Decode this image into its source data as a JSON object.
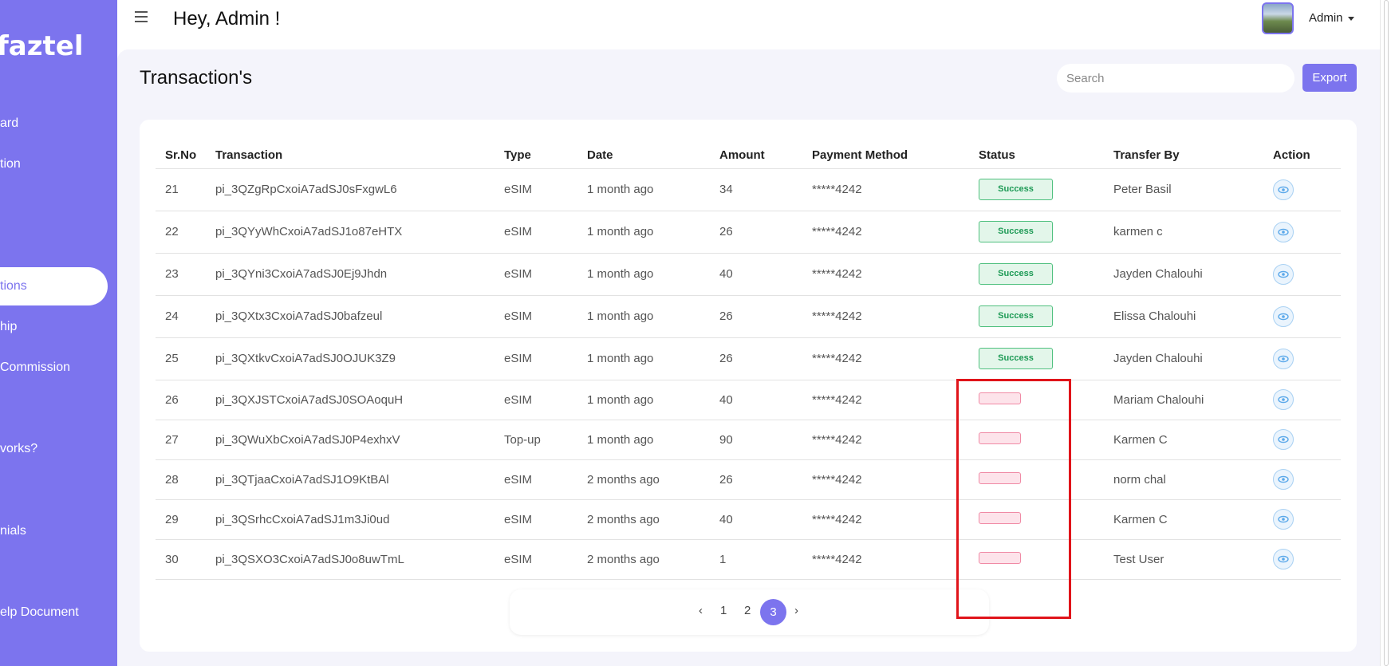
{
  "sidebar": {
    "logo": "faztel",
    "items": [
      {
        "label": "ard",
        "active": false
      },
      {
        "label": "tion",
        "active": false
      },
      {
        "label": "tions",
        "active": true
      },
      {
        "label": "hip",
        "active": false
      },
      {
        "label": " Commission",
        "active": false
      },
      {
        "label": "vorks?",
        "active": false
      },
      {
        "label": "nials",
        "active": false
      },
      {
        "label": "elp Document",
        "active": false
      }
    ]
  },
  "header": {
    "greeting": "Hey, Admin !",
    "user": "Admin"
  },
  "page": {
    "title": "Transaction's",
    "search_placeholder": "Search",
    "export_label": "Export"
  },
  "table": {
    "columns": [
      "Sr.No",
      "Transaction",
      "Type",
      "Date",
      "Amount",
      "Payment Method",
      "Status",
      "Transfer By",
      "Action"
    ],
    "rows": [
      {
        "sr": "21",
        "txn": "pi_3QZgRpCxoiA7adSJ0sFxgwL6",
        "type": "eSIM",
        "date": "1 month ago",
        "amount": "34",
        "method": "*****4242",
        "status": "Success",
        "by": "Peter Basil"
      },
      {
        "sr": "22",
        "txn": "pi_3QYyWhCxoiA7adSJ1o87eHTX",
        "type": "eSIM",
        "date": "1 month ago",
        "amount": "26",
        "method": "*****4242",
        "status": "Success",
        "by": "karmen c"
      },
      {
        "sr": "23",
        "txn": "pi_3QYni3CxoiA7adSJ0Ej9Jhdn",
        "type": "eSIM",
        "date": "1 month ago",
        "amount": "40",
        "method": "*****4242",
        "status": "Success",
        "by": "Jayden Chalouhi"
      },
      {
        "sr": "24",
        "txn": "pi_3QXtx3CxoiA7adSJ0bafzeul",
        "type": "eSIM",
        "date": "1 month ago",
        "amount": "26",
        "method": "*****4242",
        "status": "Success",
        "by": "Elissa Chalouhi"
      },
      {
        "sr": "25",
        "txn": "pi_3QXtkvCxoiA7adSJ0OJUK3Z9",
        "type": "eSIM",
        "date": "1 month ago",
        "amount": "26",
        "method": "*****4242",
        "status": "Success",
        "by": "Jayden Chalouhi"
      },
      {
        "sr": "26",
        "txn": "pi_3QXJSTCxoiA7adSJ0SOAoquH",
        "type": "eSIM",
        "date": "1 month ago",
        "amount": "40",
        "method": "*****4242",
        "status": "",
        "by": "Mariam Chalouhi"
      },
      {
        "sr": "27",
        "txn": "pi_3QWuXbCxoiA7adSJ0P4exhxV",
        "type": "Top-up",
        "date": "1 month ago",
        "amount": "90",
        "method": "*****4242",
        "status": "",
        "by": "Karmen C"
      },
      {
        "sr": "28",
        "txn": "pi_3QTjaaCxoiA7adSJ1O9KtBAl",
        "type": "eSIM",
        "date": "2 months ago",
        "amount": "26",
        "method": "*****4242",
        "status": "",
        "by": "norm chal"
      },
      {
        "sr": "29",
        "txn": "pi_3QSrhcCxoiA7adSJ1m3Ji0ud",
        "type": "eSIM",
        "date": "2 months ago",
        "amount": "40",
        "method": "*****4242",
        "status": "",
        "by": "Karmen C"
      },
      {
        "sr": "30",
        "txn": "pi_3QSXO3CxoiA7adSJ0o8uwTmL",
        "type": "eSIM",
        "date": "2 months ago",
        "amount": "1",
        "method": "*****4242",
        "status": "",
        "by": "Test User"
      }
    ]
  },
  "pagination": {
    "prev": "‹",
    "pages": [
      "1",
      "2",
      "3"
    ],
    "current": "3",
    "next": "›"
  },
  "colors": {
    "brand": "#7c74ee",
    "success": "#1d9a55",
    "failed": "#f08aa5",
    "highlight": "#e0141a"
  },
  "icons": {
    "action": "eye-icon",
    "menu": "hamburger-menu-icon"
  }
}
